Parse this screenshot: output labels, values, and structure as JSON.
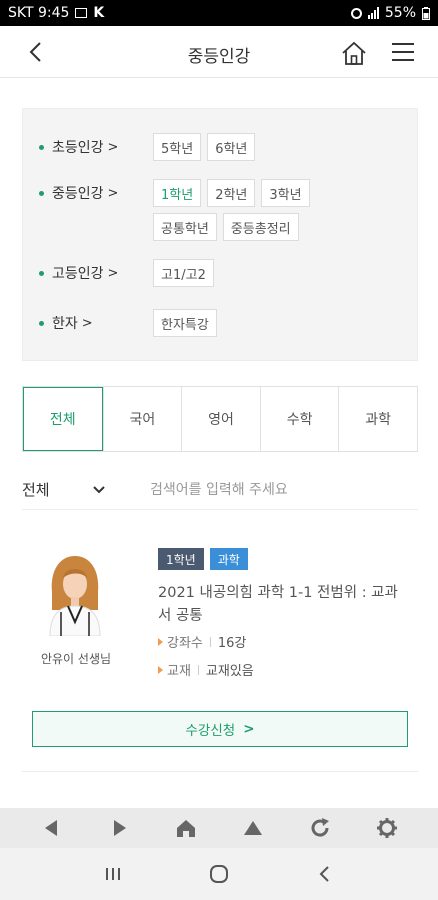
{
  "status_bar": {
    "carrier_time": "SKT 9:45",
    "k_icon_label": "K",
    "battery": "55%"
  },
  "header": {
    "title": "중등인강"
  },
  "grades": {
    "elementary": {
      "label": "초등인강",
      "arrow": ">",
      "items": [
        "5학년",
        "6학년"
      ]
    },
    "middle": {
      "label": "중등인강",
      "arrow": ">",
      "items": [
        "1학년",
        "2학년",
        "3학년",
        "공통학년",
        "중등총정리"
      ],
      "selected": "1학년"
    },
    "high": {
      "label": "고등인강",
      "arrow": ">",
      "items": [
        "고1/고2"
      ]
    },
    "hanja": {
      "label": "한자",
      "arrow": ">",
      "items": [
        "한자특강"
      ]
    }
  },
  "tabs": [
    {
      "label": "전체",
      "active": true
    },
    {
      "label": "국어",
      "active": false
    },
    {
      "label": "영어",
      "active": false
    },
    {
      "label": "수학",
      "active": false
    },
    {
      "label": "과학",
      "active": false
    }
  ],
  "filter": {
    "selected": "전체",
    "search_placeholder": "검색어를 입력해 주세요"
  },
  "course": {
    "badge_grade": "1학년",
    "badge_subject": "과학",
    "title": "2021 내공의힘 과학 1-1 전범위 : 교과서 공통",
    "lecture_count_label": "강좌수",
    "lecture_count": "16강",
    "textbook_label": "교재",
    "textbook_value": "교재있음",
    "teacher": "안유이 선생님",
    "enroll_label": "수강신청",
    "enroll_arrow": ">"
  },
  "colors": {
    "accent": "#1f9e6d",
    "badge_grade_bg": "#4a5a70",
    "badge_subject_bg": "#3b8fd9",
    "meta_triangle": "#f29b54"
  },
  "icons": {
    "header": [
      "back-arrow-icon",
      "home-icon",
      "hamburger-menu-icon"
    ],
    "toolbar": [
      "back-triangle-icon",
      "forward-triangle-icon",
      "home-icon",
      "up-triangle-icon",
      "refresh-icon",
      "settings-gear-icon"
    ],
    "system": [
      "recent-apps-icon",
      "home-circle-icon",
      "back-chevron-icon"
    ]
  }
}
